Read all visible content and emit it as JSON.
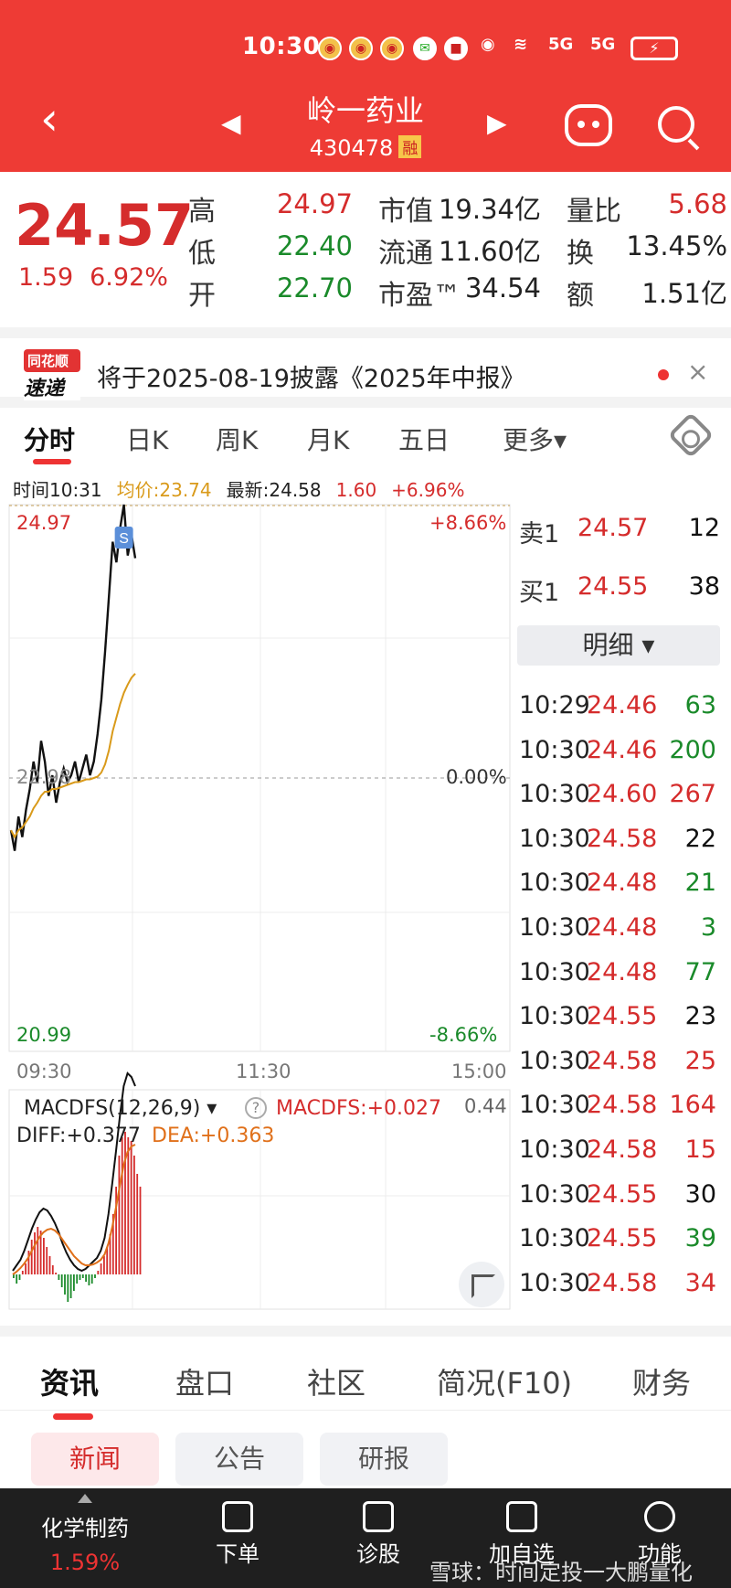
{
  "status_bar": {
    "time": "10:30",
    "signal1": "5G",
    "signal2": "5G"
  },
  "header": {
    "name": "岭一药业",
    "code": "430478",
    "badge": "融"
  },
  "quote": {
    "price": "24.57",
    "change": "1.59",
    "change_pct": "6.92%",
    "labels": {
      "high": "高",
      "low": "低",
      "open": "开",
      "mcap": "市值",
      "float": "流通",
      "pe": "市盈™",
      "vr": "量比",
      "turnover": "换",
      "amount": "额"
    },
    "values": {
      "high": "24.97",
      "low": "22.40",
      "open": "22.70",
      "mcap": "19.34亿",
      "float": "11.60亿",
      "pe": "34.54",
      "vr": "5.68",
      "turnover": "13.45%",
      "amount": "1.51亿"
    }
  },
  "news_strip": {
    "logo_line1": "同花顺",
    "logo_line2": "速递",
    "text": "将于2025-08-19披露《2025年中报》",
    "close": "×"
  },
  "chart_tabs": [
    "分时",
    "日K",
    "周K",
    "月K",
    "五日",
    "更多▾"
  ],
  "info_line": {
    "time": "时间10:31",
    "avg": "均价:23.74",
    "latest": "最新:24.58",
    "change": "1.60",
    "pct": "+6.96%"
  },
  "chart_data": {
    "type": "line",
    "y_top_label": "24.97",
    "y_mid_label": "22.98",
    "y_bottom_label": "20.99",
    "pct_top": "+8.66%",
    "pct_mid": "0.00%",
    "pct_bottom": "-8.66%",
    "x_ticks": [
      "09:30",
      "11:30",
      "15:00"
    ],
    "ylim": [
      20.99,
      24.97
    ],
    "prev_close": 22.98,
    "series": [
      {
        "values": [
          22.6,
          22.45,
          22.7,
          22.55,
          22.75,
          22.9,
          23.1,
          22.95,
          23.25,
          23.1,
          22.85,
          23.0,
          22.8,
          22.95,
          23.05,
          22.95,
          23.0,
          23.1,
          22.95,
          23.05,
          23.15,
          23.0,
          23.1,
          23.3,
          23.55,
          23.9,
          24.3,
          24.7,
          24.55,
          24.8,
          24.97,
          24.6,
          24.75,
          24.58
        ]
      },
      {
        "values": [
          22.6,
          22.55,
          22.6,
          22.62,
          22.66,
          22.7,
          22.76,
          22.8,
          22.85,
          22.88,
          22.88,
          22.9,
          22.9,
          22.91,
          22.92,
          22.93,
          22.94,
          22.95,
          22.95,
          22.96,
          22.97,
          22.97,
          22.98,
          22.99,
          23.02,
          23.08,
          23.18,
          23.32,
          23.42,
          23.52,
          23.6,
          23.66,
          23.71,
          23.74
        ]
      }
    ],
    "marker": "S"
  },
  "order_book": {
    "sell": {
      "label": "卖1",
      "price": "24.57",
      "vol": "12"
    },
    "buy": {
      "label": "买1",
      "price": "24.55",
      "vol": "38"
    },
    "detail": "明细 ▾"
  },
  "trades": [
    {
      "t": "10:29",
      "p": "24.46",
      "v": "63",
      "c": "green"
    },
    {
      "t": "10:30",
      "p": "24.46",
      "v": "200",
      "c": "green"
    },
    {
      "t": "10:30",
      "p": "24.60",
      "v": "267",
      "c": "red"
    },
    {
      "t": "10:30",
      "p": "24.58",
      "v": "22",
      "c": "black"
    },
    {
      "t": "10:30",
      "p": "24.48",
      "v": "21",
      "c": "green"
    },
    {
      "t": "10:30",
      "p": "24.48",
      "v": "3",
      "c": "green"
    },
    {
      "t": "10:30",
      "p": "24.48",
      "v": "77",
      "c": "green"
    },
    {
      "t": "10:30",
      "p": "24.55",
      "v": "23",
      "c": "black"
    },
    {
      "t": "10:30",
      "p": "24.58",
      "v": "25",
      "c": "red"
    },
    {
      "t": "10:30",
      "p": "24.58",
      "v": "164",
      "c": "red"
    },
    {
      "t": "10:30",
      "p": "24.58",
      "v": "15",
      "c": "red"
    },
    {
      "t": "10:30",
      "p": "24.55",
      "v": "30",
      "c": "black"
    },
    {
      "t": "10:30",
      "p": "24.55",
      "v": "39",
      "c": "green"
    },
    {
      "t": "10:30",
      "p": "24.58",
      "v": "34",
      "c": "red"
    }
  ],
  "macd": {
    "name": "MACDFS(12,26,9) ▾",
    "value": "MACDFS:+0.027",
    "scale": "0.44",
    "diff": "DIFF:+0.377",
    "dea": "DEA:+0.363",
    "help": "?"
  },
  "info_tabs": [
    "资讯",
    "盘口",
    "社区",
    "简况(F10)",
    "财务"
  ],
  "sub_tabs": [
    "新闻",
    "公告",
    "研报"
  ],
  "bottom_nav": {
    "sector": "化学制药",
    "sector_pct": "1.59%",
    "items": [
      "下单",
      "诊股",
      "加自选",
      "功能"
    ],
    "watermark": "雪球：时间定投一大鹏量化"
  },
  "colors": {
    "accent": "#ee3b35",
    "up": "#d52c2c",
    "down": "#1a8a2a",
    "avg_line": "#d99a1a"
  }
}
